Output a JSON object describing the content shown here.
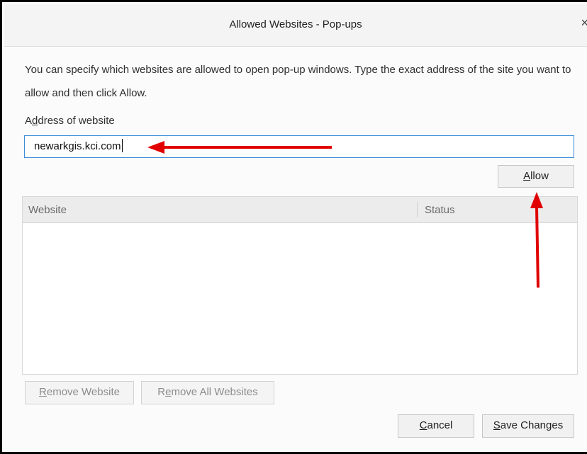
{
  "dialog": {
    "title": "Allowed Websites - Pop-ups",
    "close_glyph": "×",
    "description": "You can specify which websites are allowed to open pop-up windows. Type the exact address of the site you want to allow and then click Allow."
  },
  "address": {
    "label": "Address of website",
    "value": "newarkgis.kci.com"
  },
  "allow_button": "Allow",
  "table": {
    "columns": [
      "Website",
      "Status"
    ],
    "rows": []
  },
  "buttons": {
    "remove_website": "Remove Website",
    "remove_all_websites": "Remove All Websites",
    "cancel": "Cancel",
    "save_changes": "Save Changes"
  },
  "annotations": {
    "arrow_color": "#e00000"
  },
  "colors": {
    "input_border": "#3d8fd6"
  }
}
